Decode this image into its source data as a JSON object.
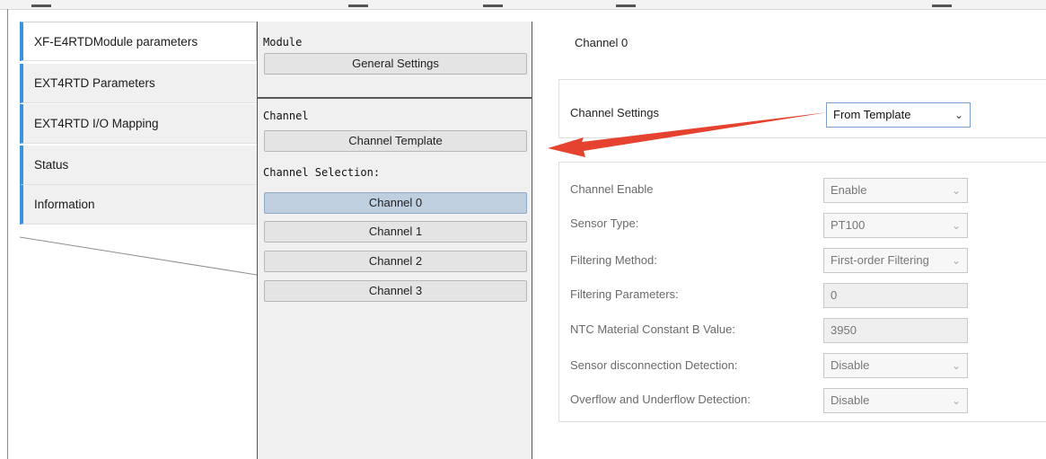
{
  "nav": {
    "items": [
      {
        "label": "XF-E4RTDModule parameters"
      },
      {
        "label": "EXT4RTD Parameters"
      },
      {
        "label": "EXT4RTD I/O Mapping"
      },
      {
        "label": "Status"
      },
      {
        "label": "Information"
      }
    ]
  },
  "middle": {
    "module_header": "Module",
    "general_settings": "General Settings",
    "channel_header": "Channel",
    "channel_template": "Channel Template",
    "channel_selection_label": "Channel Selection:",
    "channels": [
      "Channel 0",
      "Channel 1",
      "Channel 2",
      "Channel 3"
    ],
    "selected_channel": "Channel 0"
  },
  "right": {
    "title": "Channel 0",
    "channel_settings": {
      "label": "Channel Settings",
      "value": "From Template"
    },
    "fields": [
      {
        "label": "Channel Enable",
        "value": "Enable",
        "kind": "select"
      },
      {
        "label": "Sensor Type:",
        "value": "PT100",
        "kind": "select"
      },
      {
        "label": "Filtering Method:",
        "value": "First-order Filtering",
        "kind": "select"
      },
      {
        "label": "Filtering Parameters:",
        "value": "0",
        "kind": "input"
      },
      {
        "label": "NTC Material Constant B Value:",
        "value": "3950",
        "kind": "input"
      },
      {
        "label": "Sensor disconnection Detection:",
        "value": "Disable",
        "kind": "select"
      },
      {
        "label": "Overflow and Underflow Detection:",
        "value": "Disable",
        "kind": "select"
      }
    ]
  },
  "colors": {
    "accent": "#3b93e0",
    "arrow": "#e5432f",
    "selected": "#bfcfe0"
  },
  "icons": {
    "dropdown": "chevron-down-icon",
    "annotation": "red-arrow-icon"
  }
}
